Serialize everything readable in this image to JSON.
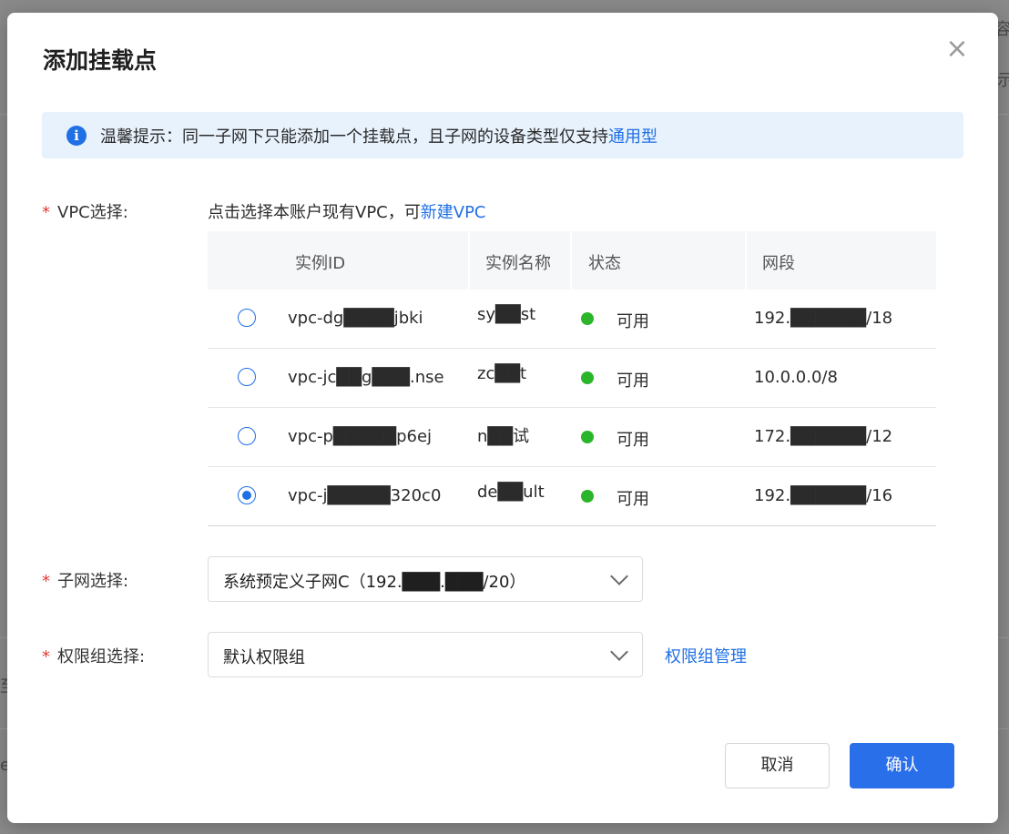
{
  "background": {
    "fragments": [
      "容",
      "示",
      "至",
      "e"
    ]
  },
  "modal": {
    "title": "添加挂载点",
    "close_icon": "×"
  },
  "tip": {
    "icon": "i",
    "text": "温馨提示：同一子网下只能添加一个挂载点，且子网的设备类型仅支持",
    "link": "通用型"
  },
  "vpc": {
    "required_mark": "*",
    "label": "VPC选择:",
    "hint": "点击选择本账户现有VPC，可",
    "hint_link": "新建VPC",
    "columns": [
      "实例ID",
      "实例名称",
      "状态",
      "网段"
    ],
    "rows": [
      {
        "id": "vpc-dg████jbki",
        "name": "sy██st",
        "status": "可用",
        "cidr": "192.██████/18",
        "selected": false
      },
      {
        "id": "vpc-jc██g███.nse",
        "name": "zc██t",
        "status": "可用",
        "cidr": "10.0.0.0/8",
        "selected": false
      },
      {
        "id": "vpc-p█████p6ej",
        "name": "n██试",
        "status": "可用",
        "cidr": "172.██████/12",
        "selected": false
      },
      {
        "id": "vpc-j█████320c0",
        "name": "de██ult",
        "status": "可用",
        "cidr": "192.██████/16",
        "selected": true
      }
    ]
  },
  "subnet": {
    "required_mark": "*",
    "label": "子网选择:",
    "value": "系统预定义子网C（192.███.███/20）"
  },
  "permission": {
    "required_mark": "*",
    "label": "权限组选择:",
    "value": "默认权限组",
    "link": "权限组管理"
  },
  "footer": {
    "cancel": "取消",
    "confirm": "确认"
  },
  "colors": {
    "primary": "#2a6fea",
    "status_ok": "#2ab52a",
    "required": "#e53935",
    "tip_bg": "#e8f2fd"
  }
}
